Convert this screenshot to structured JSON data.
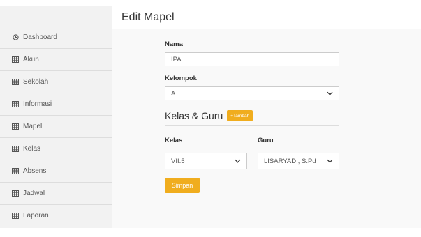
{
  "sidebar": {
    "items": [
      {
        "label": "Dashboard",
        "icon": "clock-icon"
      },
      {
        "label": "Akun",
        "icon": "table-icon"
      },
      {
        "label": "Sekolah",
        "icon": "table-icon"
      },
      {
        "label": "Informasi",
        "icon": "table-icon"
      },
      {
        "label": "Mapel",
        "icon": "table-icon"
      },
      {
        "label": "Kelas",
        "icon": "table-icon"
      },
      {
        "label": "Absensi",
        "icon": "table-icon"
      },
      {
        "label": "Jadwal",
        "icon": "table-icon"
      },
      {
        "label": "Laporan",
        "icon": "table-icon"
      }
    ]
  },
  "header": {
    "title": "Edit Mapel"
  },
  "form": {
    "nama_label": "Nama",
    "nama_value": "IPA",
    "kelompok_label": "Kelompok",
    "kelompok_value": "A",
    "section_title": "Kelas & Guru",
    "tambah_label": "+Tambah",
    "kelas_label": "Kelas",
    "kelas_value": "VII.5",
    "guru_label": "Guru",
    "guru_value": "LISARYADI, S.Pd",
    "simpan_label": "Simpan"
  },
  "colors": {
    "accent": "#f0ad1e",
    "sidebar_bg": "#f2f2f2",
    "main_bg": "#f9f9f9"
  }
}
